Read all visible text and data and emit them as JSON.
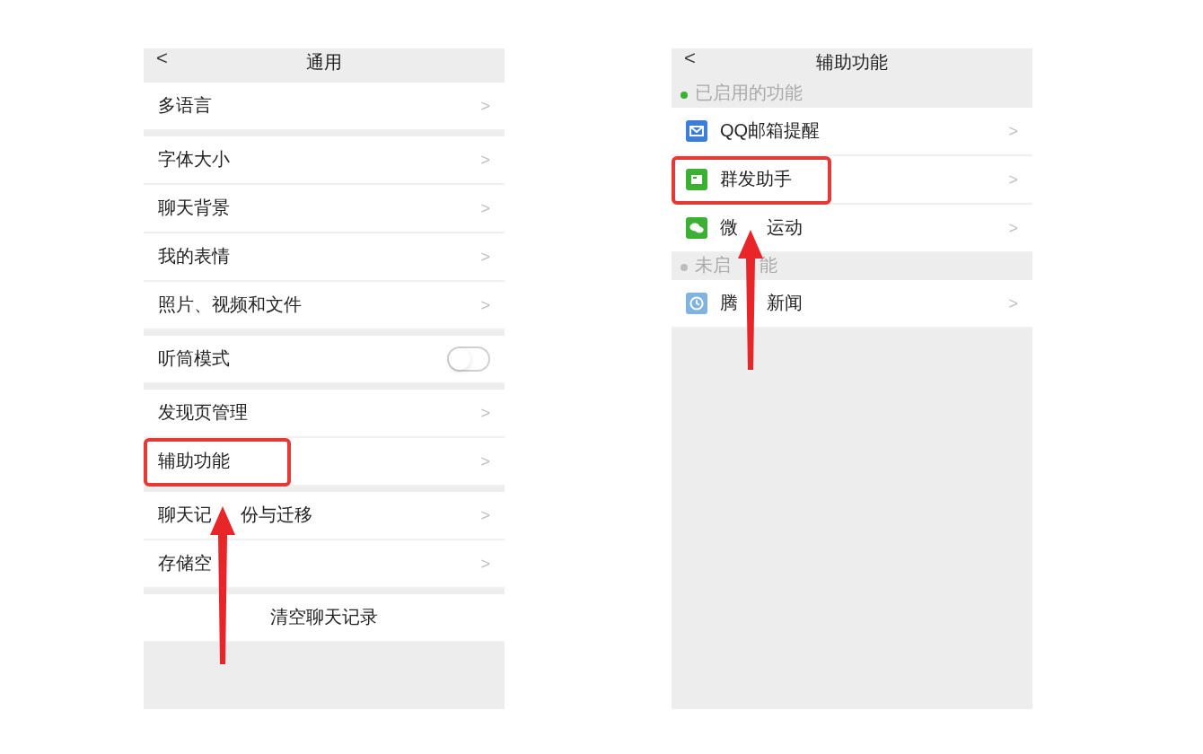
{
  "screens": [
    {
      "title": "通用",
      "back": "<",
      "groups": [
        {
          "rows": [
            {
              "kind": "item",
              "label": "多语言",
              "chevron": ">",
              "highlighted": false
            }
          ]
        },
        {
          "rows": [
            {
              "kind": "item",
              "label": "字体大小",
              "chevron": ">",
              "highlighted": false
            },
            {
              "kind": "item",
              "label": "聊天背景",
              "chevron": ">",
              "highlighted": false
            },
            {
              "kind": "item",
              "label": "我的表情",
              "chevron": ">",
              "highlighted": false
            },
            {
              "kind": "item",
              "label": "照片、视频和文件",
              "chevron": ">",
              "highlighted": false
            }
          ]
        },
        {
          "rows": [
            {
              "kind": "toggle",
              "label": "听筒模式",
              "on": false,
              "highlighted": false
            }
          ]
        },
        {
          "rows": [
            {
              "kind": "item",
              "label": "发现页管理",
              "chevron": ">",
              "highlighted": false
            },
            {
              "kind": "item",
              "label": "辅助功能",
              "chevron": ">",
              "highlighted": true
            }
          ]
        },
        {
          "rows": [
            {
              "kind": "item",
              "label": "聊天记",
              "label_rest": "份与迁移",
              "chevron": ">",
              "highlighted": false
            },
            {
              "kind": "item",
              "label": "存储空",
              "chevron": ">",
              "highlighted": false
            }
          ]
        },
        {
          "rows": [
            {
              "kind": "action",
              "label": "清空聊天记录",
              "highlighted": false
            }
          ]
        }
      ]
    },
    {
      "title": "辅助功能",
      "back": "<",
      "groups": [
        {
          "heading": "已启用的功能",
          "color": "#3cb034",
          "rows": [
            {
              "kind": "item",
              "label": "QQ邮箱提醒",
              "chevron": ">",
              "color": "#3b7dd8",
              "highlighted": false
            },
            {
              "kind": "item",
              "label": "群发助手",
              "chevron": ">",
              "color": "#3cb034",
              "highlighted": true
            },
            {
              "kind": "item",
              "label": "微",
              "label_rest": "运动",
              "chevron": ">",
              "color": "#3cb034",
              "highlighted": false
            }
          ]
        },
        {
          "heading": "未启",
          "heading_rest": "能",
          "color": "#bdbdbd",
          "rows": [
            {
              "kind": "item",
              "label": "腾",
              "label_rest": "新闻",
              "chevron": ">",
              "color": "#7fb3e0",
              "highlighted": false
            }
          ]
        }
      ]
    }
  ]
}
